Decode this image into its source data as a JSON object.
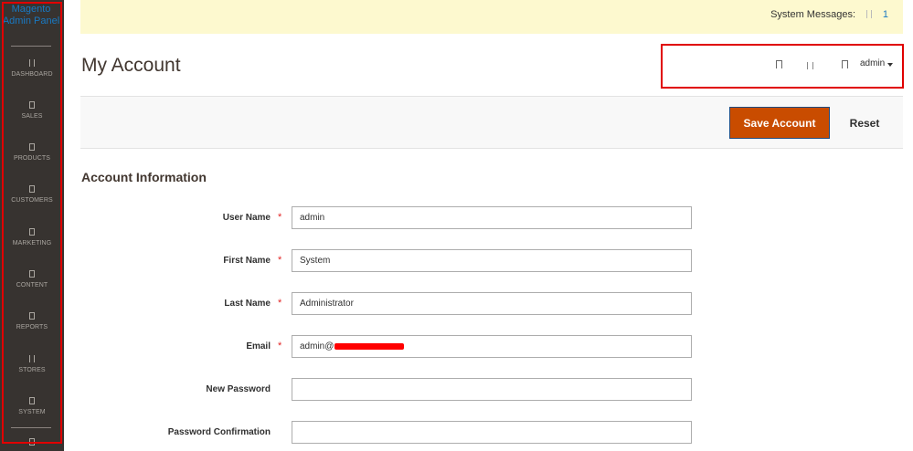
{
  "sidebar": {
    "logo_line1": "Magento",
    "logo_line2": "Admin Panel",
    "items": [
      {
        "label": "DASHBOARD",
        "icon": "dashboard-icon"
      },
      {
        "label": "SALES",
        "icon": "sales-icon"
      },
      {
        "label": "PRODUCTS",
        "icon": "products-icon"
      },
      {
        "label": "CUSTOMERS",
        "icon": "customers-icon"
      },
      {
        "label": "MARKETING",
        "icon": "marketing-icon"
      },
      {
        "label": "CONTENT",
        "icon": "content-icon"
      },
      {
        "label": "REPORTS",
        "icon": "reports-icon"
      },
      {
        "label": "STORES",
        "icon": "stores-icon"
      },
      {
        "label": "SYSTEM",
        "icon": "system-icon"
      }
    ]
  },
  "system_messages": {
    "label": "System Messages:",
    "count": "1"
  },
  "header": {
    "title": "My Account",
    "user": "admin"
  },
  "actions": {
    "save_label": "Save Account",
    "reset_label": "Reset"
  },
  "form": {
    "section_title": "Account Information",
    "fields": [
      {
        "label": "User Name",
        "value": "admin",
        "required": "*"
      },
      {
        "label": "First Name",
        "value": "System",
        "required": "*"
      },
      {
        "label": "Last Name",
        "value": "Administrator",
        "required": "*"
      },
      {
        "label": "Email",
        "value": "admin@",
        "required": "*"
      },
      {
        "label": "New Password",
        "value": ""
      },
      {
        "label": "Password Confirmation",
        "value": ""
      }
    ]
  },
  "colors": {
    "accent": "#c94c00",
    "sidebar": "#373330",
    "message_bar": "#fdf9cf",
    "highlight_frame": "#e00000"
  }
}
